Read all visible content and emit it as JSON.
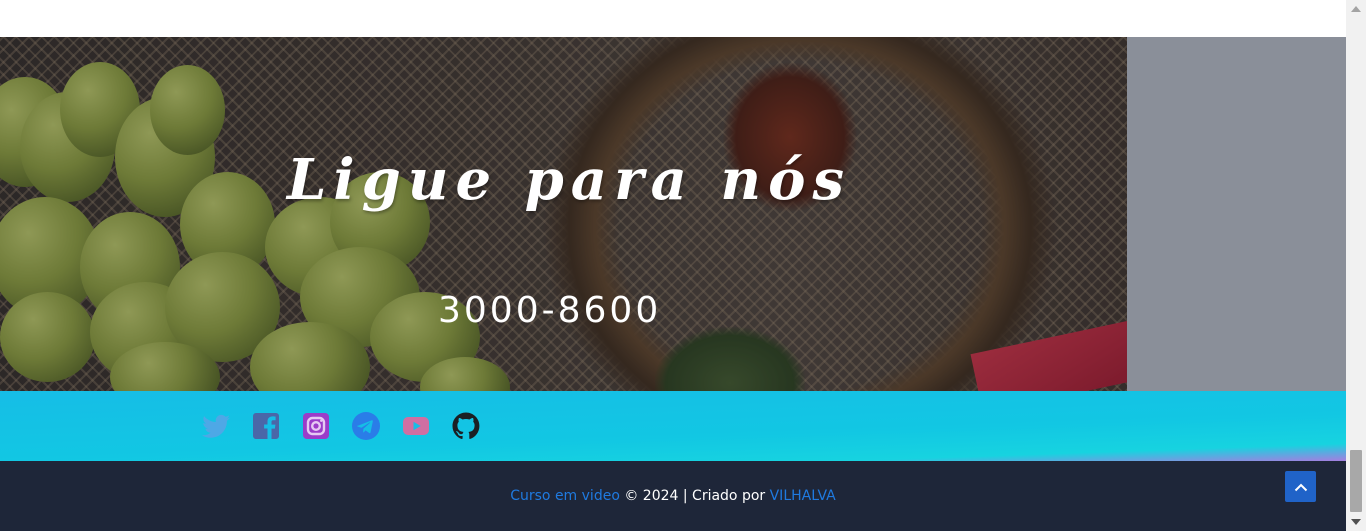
{
  "hero": {
    "title": "Ligue para nós",
    "phone": "3000-8600"
  },
  "social": {
    "icons": [
      {
        "name": "twitter-icon",
        "color": "#4ea8e6"
      },
      {
        "name": "facebook-icon",
        "color": "#4a67a8"
      },
      {
        "name": "instagram-icon",
        "color": "#9b3cc9"
      },
      {
        "name": "telegram-icon",
        "color": "#2a7de8"
      },
      {
        "name": "youtube-icon",
        "color": "#d06fa2"
      },
      {
        "name": "github-icon",
        "color": "#1b1f24"
      }
    ]
  },
  "footer": {
    "link1": "Curso em video",
    "middle": " © 2024 | Criado por ",
    "link2": "VILHALVA",
    "link_color": "#1f7ae0",
    "back_to_top_icon": "chevron-up-icon"
  },
  "colors": {
    "footer_bg": "#1e2639",
    "social_band": "#16bde6",
    "side_panel": "#8a8f99"
  }
}
